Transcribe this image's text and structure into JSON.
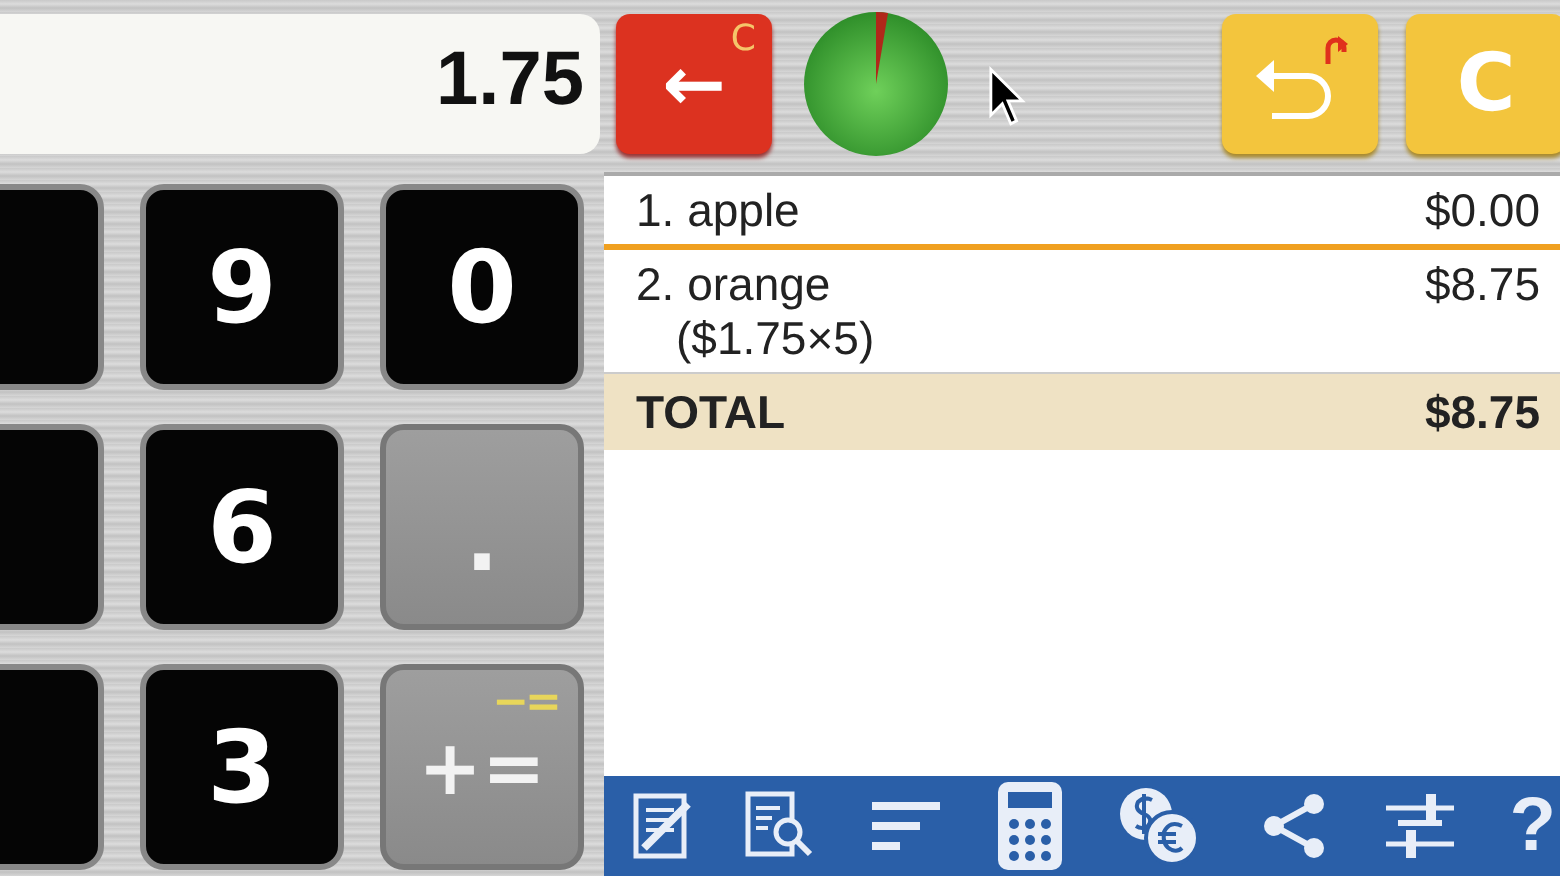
{
  "display": {
    "value": "1.75"
  },
  "backspace_button": {
    "label": "←",
    "corner": "C"
  },
  "clear_button": {
    "label": "C"
  },
  "key_rows": [
    [
      {
        "kind": "digit"
      },
      {
        "kind": "digit",
        "label": "9"
      },
      {
        "kind": "digit",
        "label": "0"
      }
    ],
    [
      {
        "kind": "digit"
      },
      {
        "kind": "digit",
        "label": "6"
      },
      {
        "kind": "dot",
        "label": "."
      }
    ],
    [
      {
        "kind": "digit"
      },
      {
        "kind": "digit",
        "label": "3"
      },
      {
        "kind": "op",
        "label": "+=",
        "corner": "−="
      }
    ]
  ],
  "items": [
    {
      "number": "1.",
      "name": "apple",
      "price": "$0.00",
      "selected": true
    },
    {
      "number": "2.",
      "name": "orange",
      "price": "$8.75",
      "detail": "($1.75×5)",
      "selected": false
    }
  ],
  "total": {
    "label": "TOTAL",
    "amount": "$8.75"
  },
  "toolbar": [
    {
      "kind": "edit"
    },
    {
      "kind": "search"
    },
    {
      "kind": "sort"
    },
    {
      "kind": "calculator"
    },
    {
      "kind": "currency"
    },
    {
      "kind": "share"
    },
    {
      "kind": "sliders"
    },
    {
      "kind": "help",
      "label": "?"
    }
  ]
}
